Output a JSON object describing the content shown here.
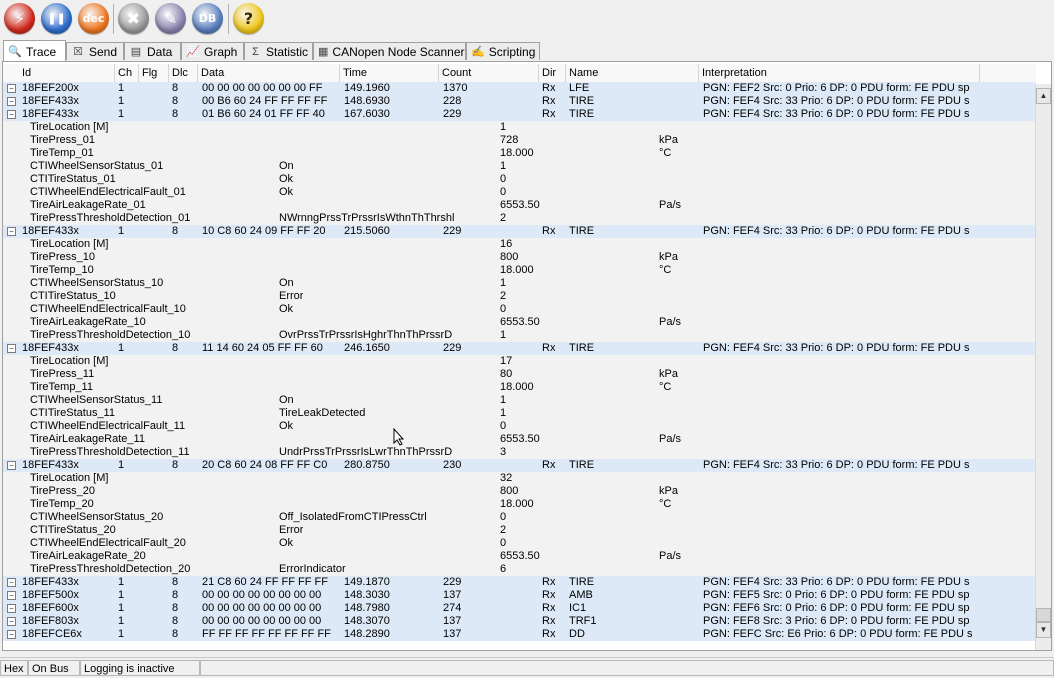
{
  "toolbar": {
    "buttons": [
      {
        "name": "connect-icon",
        "glyph": "⚡",
        "color": "#d42a1e"
      },
      {
        "name": "pause-icon",
        "glyph": "❚❚",
        "color": "#2e6fd0"
      },
      {
        "name": "dec-icon",
        "glyph": "dec",
        "color": "#f07820"
      },
      {
        "name": "tools-icon",
        "glyph": "✖",
        "color": "#9a9a9a"
      },
      {
        "name": "dbc-edit-icon",
        "glyph": "✎",
        "color": "#8a84b0"
      },
      {
        "name": "database-icon",
        "glyph": "DB",
        "color": "#5a7fc0"
      },
      {
        "name": "help-icon",
        "glyph": "?",
        "color": "#f2c81a"
      }
    ]
  },
  "tabs": [
    {
      "label": "Trace",
      "icon": "magnifier-icon",
      "glyph": "🔍"
    },
    {
      "label": "Send",
      "icon": "send-icon",
      "glyph": "☒"
    },
    {
      "label": "Data",
      "icon": "data-icon",
      "glyph": "▤"
    },
    {
      "label": "Graph",
      "icon": "graph-icon",
      "glyph": "📈"
    },
    {
      "label": "Statistic",
      "icon": "sigma-icon",
      "glyph": "Σ"
    },
    {
      "label": "CANopen Node Scanner",
      "icon": "scanner-icon",
      "glyph": "▦"
    },
    {
      "label": "Scripting",
      "icon": "script-icon",
      "glyph": "✍"
    }
  ],
  "columns": [
    "Id",
    "Ch",
    "Flg",
    "Dlc",
    "Data",
    "Time",
    "Count",
    "Dir",
    "Name",
    "Interpretation"
  ],
  "rows": [
    {
      "t": "msg",
      "id": "18FEF200x",
      "ch": "1",
      "dlc": "8",
      "data": "00 00 00 00 00 00 00 FF",
      "time": "149.1960",
      "count": "1370",
      "dir": "Rx",
      "name": "LFE",
      "interp": "PGN: FEF2 Src: 0 Prio: 6 DP: 0 PDU form: FE PDU sp"
    },
    {
      "t": "msg",
      "id": "18FEF433x",
      "ch": "1",
      "dlc": "8",
      "data": "00 B6 60 24 FF FF FF FF",
      "time": "148.6930",
      "count": "228",
      "dir": "Rx",
      "name": "TIRE",
      "interp": "PGN: FEF4 Src: 33 Prio: 6 DP: 0 PDU form: FE PDU s"
    },
    {
      "t": "msg",
      "id": "18FEF433x",
      "ch": "1",
      "dlc": "8",
      "data": "01 B6 60 24 01 FF FF 40",
      "time": "167.6030",
      "count": "229",
      "dir": "Rx",
      "name": "TIRE",
      "interp": "PGN: FEF4 Src: 33 Prio: 6 DP: 0 PDU form: FE PDU s"
    },
    {
      "t": "sig",
      "sname": "TireLocation [M]",
      "sval": "",
      "num": "1",
      "unit": ""
    },
    {
      "t": "sig",
      "sname": "TirePress_01",
      "sval": "",
      "num": "728",
      "unit": "kPa"
    },
    {
      "t": "sig",
      "sname": "TireTemp_01",
      "sval": "",
      "num": "18.000",
      "unit": "°C"
    },
    {
      "t": "sig",
      "sname": "CTIWheelSensorStatus_01",
      "sval": "On",
      "num": "1",
      "unit": ""
    },
    {
      "t": "sig",
      "sname": "CTITireStatus_01",
      "sval": "Ok",
      "num": "0",
      "unit": ""
    },
    {
      "t": "sig",
      "sname": "CTIWheelEndElectricalFault_01",
      "sval": "Ok",
      "num": "0",
      "unit": ""
    },
    {
      "t": "sig",
      "sname": "TireAirLeakageRate_01",
      "sval": "",
      "num": "6553.50",
      "unit": "Pa/s"
    },
    {
      "t": "sig",
      "sname": "TirePressThresholdDetection_01",
      "sval": "NWrnngPrssTrPrssrIsWthnThThrshl",
      "num": "2",
      "unit": ""
    },
    {
      "t": "msg",
      "id": "18FEF433x",
      "ch": "1",
      "dlc": "8",
      "data": "10 C8 60 24 09 FF FF 20",
      "time": "215.5060",
      "count": "229",
      "dir": "Rx",
      "name": "TIRE",
      "interp": "PGN: FEF4 Src: 33 Prio: 6 DP: 0 PDU form: FE PDU s"
    },
    {
      "t": "sig",
      "sname": "TireLocation [M]",
      "sval": "",
      "num": "16",
      "unit": ""
    },
    {
      "t": "sig",
      "sname": "TirePress_10",
      "sval": "",
      "num": "800",
      "unit": "kPa"
    },
    {
      "t": "sig",
      "sname": "TireTemp_10",
      "sval": "",
      "num": "18.000",
      "unit": "°C"
    },
    {
      "t": "sig",
      "sname": "CTIWheelSensorStatus_10",
      "sval": "On",
      "num": "1",
      "unit": ""
    },
    {
      "t": "sig",
      "sname": "CTITireStatus_10",
      "sval": "Error",
      "num": "2",
      "unit": ""
    },
    {
      "t": "sig",
      "sname": "CTIWheelEndElectricalFault_10",
      "sval": "Ok",
      "num": "0",
      "unit": ""
    },
    {
      "t": "sig",
      "sname": "TireAirLeakageRate_10",
      "sval": "",
      "num": "6553.50",
      "unit": "Pa/s"
    },
    {
      "t": "sig",
      "sname": "TirePressThresholdDetection_10",
      "sval": "OvrPrssTrPrssrIsHghrThnThPrssrD",
      "num": "1",
      "unit": ""
    },
    {
      "t": "msg",
      "id": "18FEF433x",
      "ch": "1",
      "dlc": "8",
      "data": "11 14 60 24 05 FF FF 60",
      "time": "246.1650",
      "count": "229",
      "dir": "Rx",
      "name": "TIRE",
      "interp": "PGN: FEF4 Src: 33 Prio: 6 DP: 0 PDU form: FE PDU s"
    },
    {
      "t": "sig",
      "sname": "TireLocation [M]",
      "sval": "",
      "num": "17",
      "unit": ""
    },
    {
      "t": "sig",
      "sname": "TirePress_11",
      "sval": "",
      "num": "80",
      "unit": "kPa"
    },
    {
      "t": "sig",
      "sname": "TireTemp_11",
      "sval": "",
      "num": "18.000",
      "unit": "°C"
    },
    {
      "t": "sig",
      "sname": "CTIWheelSensorStatus_11",
      "sval": "On",
      "num": "1",
      "unit": ""
    },
    {
      "t": "sig",
      "sname": "CTITireStatus_11",
      "sval": "TireLeakDetected",
      "num": "1",
      "unit": ""
    },
    {
      "t": "sig",
      "sname": "CTIWheelEndElectricalFault_11",
      "sval": "Ok",
      "num": "0",
      "unit": ""
    },
    {
      "t": "sig",
      "sname": "TireAirLeakageRate_11",
      "sval": "",
      "num": "6553.50",
      "unit": "Pa/s"
    },
    {
      "t": "sig",
      "sname": "TirePressThresholdDetection_11",
      "sval": "UndrPrssTrPrssrIsLwrThnThPrssrD",
      "num": "3",
      "unit": ""
    },
    {
      "t": "msg",
      "id": "18FEF433x",
      "ch": "1",
      "dlc": "8",
      "data": "20 C8 60 24 08 FF FF C0",
      "time": "280.8750",
      "count": "230",
      "dir": "Rx",
      "name": "TIRE",
      "interp": "PGN: FEF4 Src: 33 Prio: 6 DP: 0 PDU form: FE PDU s"
    },
    {
      "t": "sig",
      "sname": "TireLocation [M]",
      "sval": "",
      "num": "32",
      "unit": ""
    },
    {
      "t": "sig",
      "sname": "TirePress_20",
      "sval": "",
      "num": "800",
      "unit": "kPa"
    },
    {
      "t": "sig",
      "sname": "TireTemp_20",
      "sval": "",
      "num": "18.000",
      "unit": "°C"
    },
    {
      "t": "sig",
      "sname": "CTIWheelSensorStatus_20",
      "sval": "Off_IsolatedFromCTIPressCtrl",
      "num": "0",
      "unit": ""
    },
    {
      "t": "sig",
      "sname": "CTITireStatus_20",
      "sval": "Error",
      "num": "2",
      "unit": ""
    },
    {
      "t": "sig",
      "sname": "CTIWheelEndElectricalFault_20",
      "sval": "Ok",
      "num": "0",
      "unit": ""
    },
    {
      "t": "sig",
      "sname": "TireAirLeakageRate_20",
      "sval": "",
      "num": "6553.50",
      "unit": "Pa/s"
    },
    {
      "t": "sig",
      "sname": "TirePressThresholdDetection_20",
      "sval": "ErrorIndicator",
      "num": "6",
      "unit": ""
    },
    {
      "t": "msg",
      "id": "18FEF433x",
      "ch": "1",
      "dlc": "8",
      "data": "21 C8 60 24 FF FF FF FF",
      "time": "149.1870",
      "count": "229",
      "dir": "Rx",
      "name": "TIRE",
      "interp": "PGN: FEF4 Src: 33 Prio: 6 DP: 0 PDU form: FE PDU s"
    },
    {
      "t": "msg",
      "id": "18FEF500x",
      "ch": "1",
      "dlc": "8",
      "data": "00 00 00 00 00 00 00 00",
      "time": "148.3030",
      "count": "137",
      "dir": "Rx",
      "name": "AMB",
      "interp": "PGN: FEF5 Src: 0 Prio: 6 DP: 0 PDU form: FE PDU sp"
    },
    {
      "t": "msg",
      "id": "18FEF600x",
      "ch": "1",
      "dlc": "8",
      "data": "00 00 00 00 00 00 00 00",
      "time": "148.7980",
      "count": "274",
      "dir": "Rx",
      "name": "IC1",
      "interp": "PGN: FEF6 Src: 0 Prio: 6 DP: 0 PDU form: FE PDU sp"
    },
    {
      "t": "msg",
      "id": "18FEF803x",
      "ch": "1",
      "dlc": "8",
      "data": "00 00 00 00 00 00 00 00",
      "time": "148.3070",
      "count": "137",
      "dir": "Rx",
      "name": "TRF1",
      "interp": "PGN: FEF8 Src: 3 Prio: 6 DP: 0 PDU form: FE PDU sp"
    },
    {
      "t": "msg",
      "id": "18FEFCE6x",
      "ch": "1",
      "dlc": "8",
      "data": "FF FF FF FF FF FF FF FF",
      "time": "148.2890",
      "count": "137",
      "dir": "Rx",
      "name": "DD",
      "interp": "PGN: FEFC Src: E6 Prio: 6 DP: 0 PDU form: FE PDU s"
    }
  ],
  "statusbar": {
    "mode": "Hex",
    "bus": "On Bus",
    "logging": "Logging is inactive"
  }
}
